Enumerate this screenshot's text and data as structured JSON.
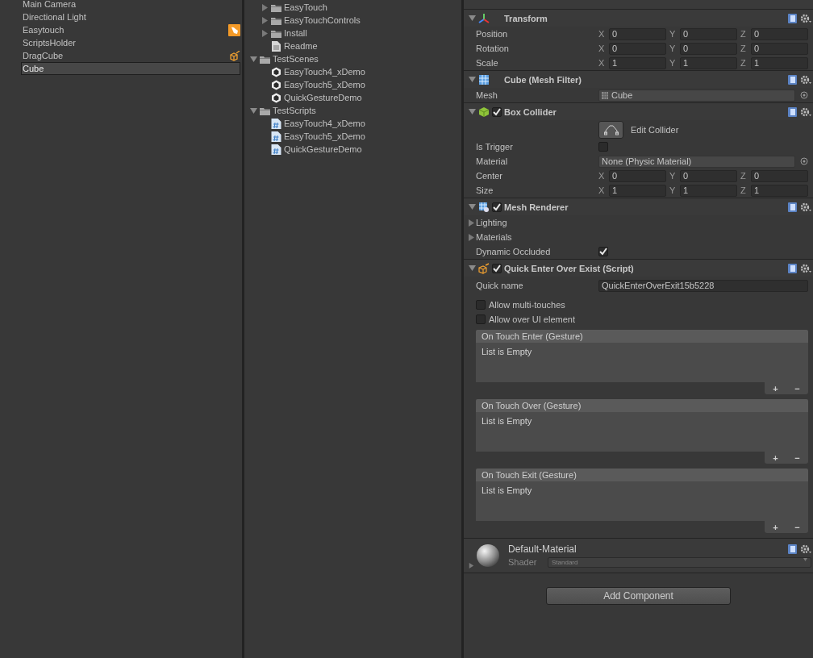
{
  "hierarchy": {
    "items": [
      {
        "label": "Main Camera",
        "selected": false
      },
      {
        "label": "Directional Light",
        "selected": false
      },
      {
        "label": "Easytouch",
        "selected": false,
        "kind": "badge"
      },
      {
        "label": "ScriptsHolder",
        "selected": false
      },
      {
        "label": "DragCube",
        "selected": false,
        "kind": "script"
      },
      {
        "label": "Cube",
        "selected": true,
        "renaming": true
      }
    ]
  },
  "project": {
    "continued_items": [
      {
        "label": "EasyTouch",
        "kind": "folder",
        "expanded": false
      },
      {
        "label": "EasyTouchControls",
        "kind": "folder",
        "expanded": false
      },
      {
        "label": "Install",
        "kind": "folder",
        "expanded": false
      },
      {
        "label": "Readme",
        "kind": "file"
      }
    ],
    "tree": [
      {
        "label": "TestScenes",
        "kind": "folder",
        "expanded": true,
        "children": [
          {
            "label": "EasyTouch4_xDemo",
            "kind": "scene"
          },
          {
            "label": "EasyTouch5_xDemo",
            "kind": "scene"
          },
          {
            "label": "QuickGestureDemo",
            "kind": "scene"
          }
        ]
      },
      {
        "label": "TestScripts",
        "kind": "folder",
        "expanded": true,
        "children": [
          {
            "label": "EasyTouch4_xDemo",
            "kind": "script"
          },
          {
            "label": "EasyTouch5_xDemo",
            "kind": "script"
          },
          {
            "label": "QuickGestureDemo",
            "kind": "script"
          }
        ]
      }
    ]
  },
  "inspector": {
    "components": [
      {
        "title": "Transform",
        "kind": "transform",
        "expanded": true,
        "rows": [
          {
            "kind": "vector",
            "label": "Position",
            "fields": [
              {
                "axis": "X",
                "value": "0"
              },
              {
                "axis": "Y",
                "value": "0"
              },
              {
                "axis": "Z",
                "value": "0"
              }
            ]
          },
          {
            "kind": "vector",
            "label": "Rotation",
            "fields": [
              {
                "axis": "X",
                "value": "0"
              },
              {
                "axis": "Y",
                "value": "0"
              },
              {
                "axis": "Z",
                "value": "0"
              }
            ]
          },
          {
            "kind": "vector",
            "label": "Scale",
            "fields": [
              {
                "axis": "X",
                "value": "1"
              },
              {
                "axis": "Y",
                "value": "1"
              },
              {
                "axis": "Z",
                "value": "1"
              }
            ]
          }
        ]
      },
      {
        "title": "Cube (Mesh Filter)",
        "kind": "meshfilter",
        "expanded": true,
        "rows": [
          {
            "kind": "object",
            "label": "Mesh",
            "value": "Cube",
            "asset_icon": true
          }
        ]
      },
      {
        "title": "Box Collider",
        "kind": "collider",
        "enabled": true,
        "expanded": true,
        "rows": [
          {
            "kind": "button",
            "label": "Edit Collider"
          },
          {
            "kind": "checkbox",
            "label": "Is Trigger",
            "checked": false
          },
          {
            "kind": "object",
            "label": "Material",
            "value": "None (Physic Material)",
            "asset_icon": false
          },
          {
            "kind": "vector",
            "label": "Center",
            "fields": [
              {
                "axis": "X",
                "value": "0"
              },
              {
                "axis": "Y",
                "value": "0"
              },
              {
                "axis": "Z",
                "value": "0"
              }
            ]
          },
          {
            "kind": "vector",
            "label": "Size",
            "fields": [
              {
                "axis": "X",
                "value": "1"
              },
              {
                "axis": "Y",
                "value": "1"
              },
              {
                "axis": "Z",
                "value": "1"
              }
            ]
          }
        ]
      },
      {
        "title": "Mesh Renderer",
        "kind": "renderer",
        "enabled": true,
        "expanded": true,
        "rows": [
          {
            "kind": "foldout",
            "label": "Lighting",
            "expanded": false
          },
          {
            "kind": "foldout",
            "label": "Materials",
            "expanded": false
          },
          {
            "kind": "checkbox",
            "label": "Dynamic Occluded",
            "checked": true
          }
        ]
      },
      {
        "title": "Quick Enter Over Exist (Script)",
        "kind": "script",
        "enabled": true,
        "expanded": true,
        "rows": [
          {
            "kind": "text",
            "label": "Quick name",
            "value": "QuickEnterOverExit15b5228"
          },
          {
            "kind": "toggle",
            "label": "Allow multi-touches",
            "checked": false
          },
          {
            "kind": "toggle",
            "label": "Allow over UI element",
            "checked": false
          },
          {
            "kind": "event",
            "title": "On Touch Enter (Gesture)",
            "empty_text": "List is Empty",
            "add": "+",
            "remove": "−"
          },
          {
            "kind": "event",
            "title": "On Touch Over (Gesture)",
            "empty_text": "List is Empty",
            "add": "+",
            "remove": "−"
          },
          {
            "kind": "event",
            "title": "On Touch Exit (Gesture)",
            "empty_text": "List is Empty",
            "add": "+",
            "remove": "−"
          }
        ]
      }
    ],
    "material": {
      "name": "Default-Material",
      "shader_label": "Shader",
      "shader": "Standard",
      "expanded": false
    },
    "add_button": "Add Component"
  }
}
